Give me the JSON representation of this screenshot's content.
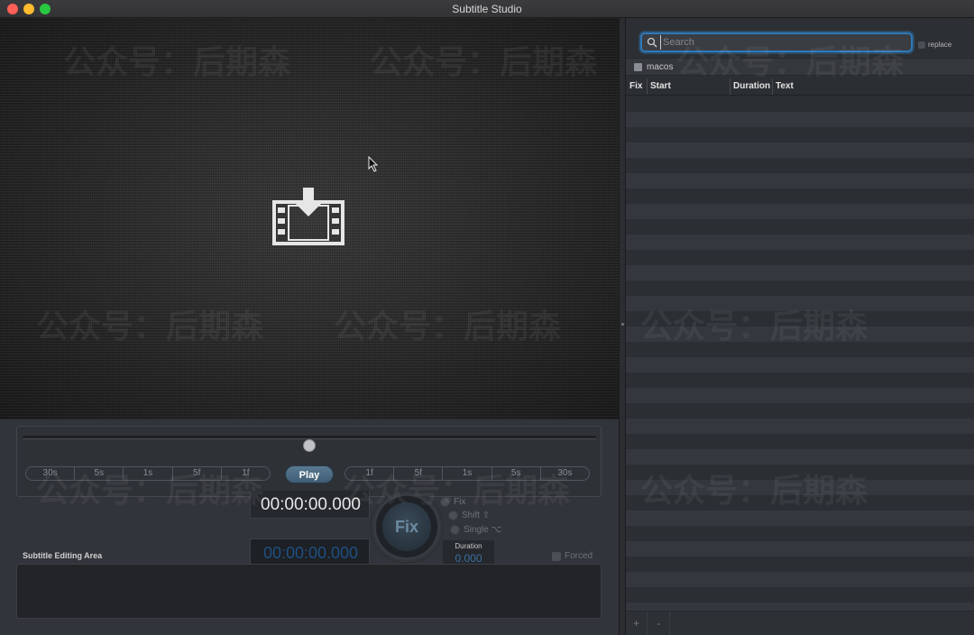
{
  "window": {
    "title": "Subtitle Studio"
  },
  "player": {
    "play_label": "Play",
    "left_steps": [
      "30s",
      "5s",
      "1s",
      "5f",
      "1f"
    ],
    "right_steps": [
      "1f",
      "5f",
      "1s",
      "5s",
      "30s"
    ],
    "progress": 0.5,
    "timecode": "00:00:00.000"
  },
  "editor": {
    "section_label": "Subtitle Editing Area",
    "start_time": "00:00:00.000",
    "fix_label": "Fix",
    "mode_options": [
      {
        "label": "Fix"
      },
      {
        "label": "Shift ⇧"
      },
      {
        "label": "Single ⌥"
      }
    ],
    "duration_label": "Duration",
    "duration_value": "0.000",
    "forced_label": "Forced"
  },
  "sidebar": {
    "search_placeholder": "Search",
    "replace_label": "replace",
    "file_name": "macos",
    "columns": [
      "Fix",
      "Start",
      "Duration",
      "Text"
    ],
    "add_label": "+",
    "remove_label": "-"
  },
  "watermark": {
    "text": "公众号：后期森"
  }
}
